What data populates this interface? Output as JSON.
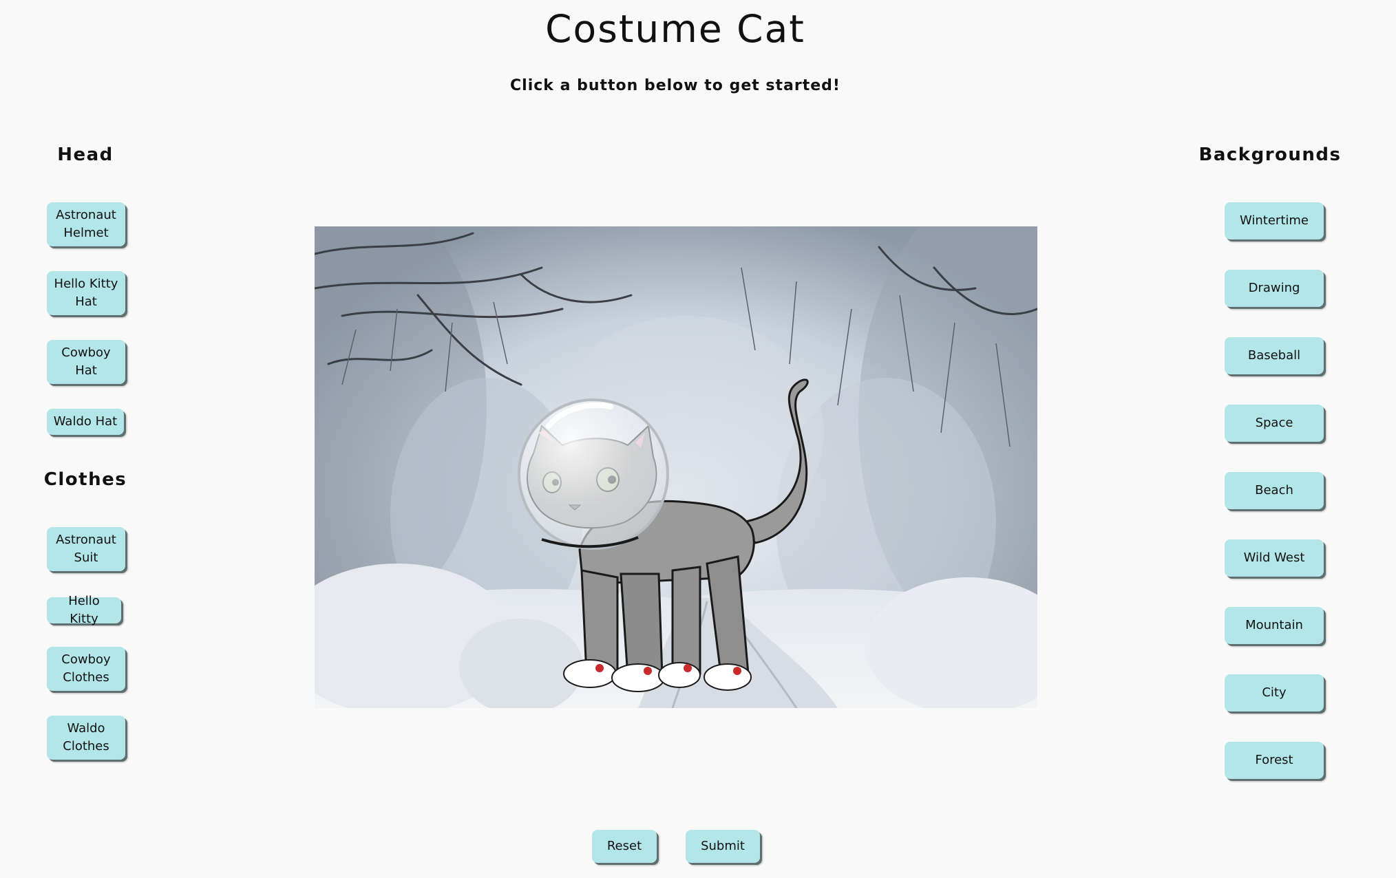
{
  "page": {
    "title": "Costume Cat",
    "subtitle": "Click a button below to get started!"
  },
  "head": {
    "heading": "Head",
    "buttons": [
      "Astronaut Helmet",
      "Hello Kitty Hat",
      "Cowboy Hat",
      "Waldo Hat"
    ]
  },
  "clothes": {
    "heading": "Clothes",
    "buttons": [
      "Astronaut Suit",
      "Hello Kitty",
      "Cowboy Clothes",
      "Waldo Clothes"
    ]
  },
  "backgrounds": {
    "heading": "Backgrounds",
    "buttons": [
      "Wintertime",
      "Drawing",
      "Baseball",
      "Space",
      "Beach",
      "Wild West",
      "Mountain",
      "City",
      "Forest"
    ]
  },
  "actions": {
    "reset": "Reset",
    "submit": "Submit"
  },
  "colors": {
    "button_fill": "#b3e6e8",
    "page_background": "#f9f9f9",
    "cat_fur": "#9a9a9a"
  },
  "scene": {
    "background": "Wintertime",
    "outfit": [
      "Astronaut Helmet",
      "Hello Kitty slippers"
    ]
  }
}
